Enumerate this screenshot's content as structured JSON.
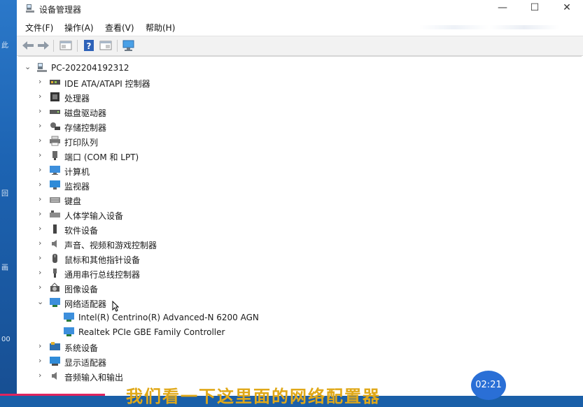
{
  "window": {
    "title": "设备管理器",
    "controls": {
      "minimize": "—",
      "maximize": "☐",
      "close": "✕"
    }
  },
  "menu": {
    "items": [
      "文件(F)",
      "操作(A)",
      "查看(V)",
      "帮助(H)"
    ]
  },
  "toolbar": {
    "buttons": [
      "back-icon",
      "forward-icon",
      "properties-icon",
      "help-icon",
      "update-driver-icon",
      "scan-hardware-icon"
    ]
  },
  "tree": {
    "root": {
      "label": "PC-202204192312",
      "expanded": true
    },
    "categories": [
      {
        "label": "IDE ATA/ATAPI 控制器",
        "icon": "ide-controller-icon",
        "expanded": false
      },
      {
        "label": "处理器",
        "icon": "processor-icon",
        "expanded": false
      },
      {
        "label": "磁盘驱动器",
        "icon": "disk-drive-icon",
        "expanded": false
      },
      {
        "label": "存储控制器",
        "icon": "storage-controller-icon",
        "expanded": false
      },
      {
        "label": "打印队列",
        "icon": "print-queue-icon",
        "expanded": false
      },
      {
        "label": "端口 (COM 和 LPT)",
        "icon": "port-icon",
        "expanded": false
      },
      {
        "label": "计算机",
        "icon": "computer-icon",
        "expanded": false
      },
      {
        "label": "监视器",
        "icon": "monitor-icon",
        "expanded": false
      },
      {
        "label": "键盘",
        "icon": "keyboard-icon",
        "expanded": false
      },
      {
        "label": "人体学输入设备",
        "icon": "hid-icon",
        "expanded": false
      },
      {
        "label": "软件设备",
        "icon": "software-device-icon",
        "expanded": false
      },
      {
        "label": "声音、视频和游戏控制器",
        "icon": "sound-icon",
        "expanded": false
      },
      {
        "label": "鼠标和其他指针设备",
        "icon": "mouse-icon",
        "expanded": false
      },
      {
        "label": "通用串行总线控制器",
        "icon": "usb-icon",
        "expanded": false
      },
      {
        "label": "图像设备",
        "icon": "imaging-icon",
        "expanded": false
      },
      {
        "label": "网络适配器",
        "icon": "network-adapter-icon",
        "expanded": true,
        "children": [
          {
            "label": "Intel(R) Centrino(R) Advanced-N 6200 AGN",
            "icon": "network-adapter-icon"
          },
          {
            "label": "Realtek PCIe GBE Family Controller",
            "icon": "network-adapter-icon"
          }
        ]
      },
      {
        "label": "系统设备",
        "icon": "system-device-icon",
        "expanded": false
      },
      {
        "label": "显示适配器",
        "icon": "display-adapter-icon",
        "expanded": false
      },
      {
        "label": "音频输入和输出",
        "icon": "audio-io-icon",
        "expanded": false
      }
    ]
  },
  "overlay": {
    "subtitle": "我们看一下这里面的网络配置器",
    "time": "02:21",
    "progress": 0.18
  },
  "desktop": {
    "side_glyphs": [
      "此",
      "回",
      "画",
      "00"
    ]
  },
  "colors": {
    "accent": "#2a6fd6",
    "subtitle": "#e0a818",
    "desktop": "#1d64b3",
    "progress": "#e0245e"
  }
}
